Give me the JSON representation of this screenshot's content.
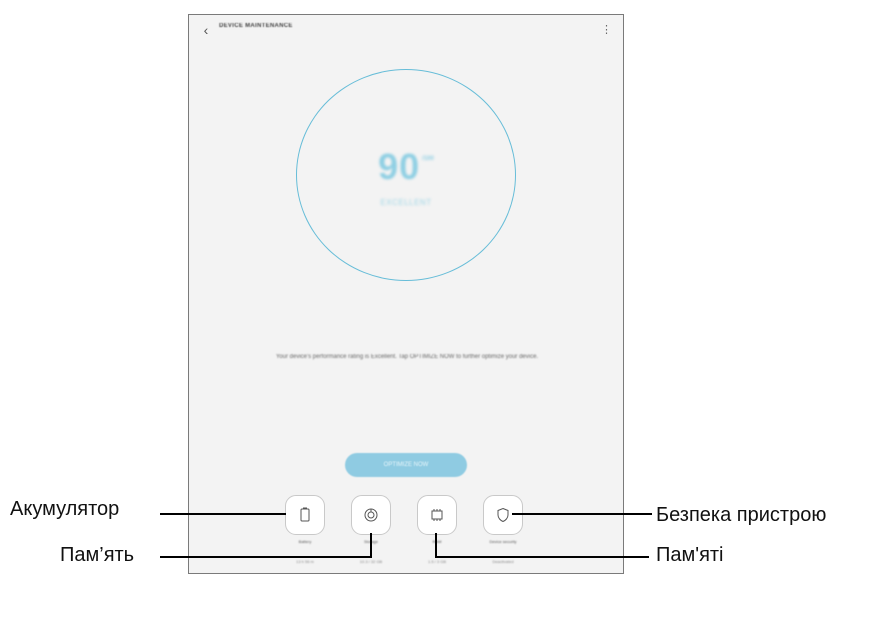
{
  "header": {
    "title": "DEVICE MAINTENANCE",
    "back_icon": "chevron-left-icon",
    "more_icon": "more-vert-icon"
  },
  "score": {
    "value": "90",
    "max": "/100",
    "rating": "EXCELLENT"
  },
  "message": "Your device's performance rating is Excellent. Tap OPTIMIZE NOW to further optimize your device.",
  "optimize_button": "OPTIMIZE NOW",
  "tiles": [
    {
      "icon": "battery-icon",
      "label": "Battery",
      "value": "13 h 56 m"
    },
    {
      "icon": "storage-icon",
      "label": "Storage",
      "value": "10.3 / 32 GB"
    },
    {
      "icon": "memory-chip-icon",
      "label": "RAM",
      "value": "1.5 / 3 GB"
    },
    {
      "icon": "shield-icon",
      "label": "Device security",
      "value": "Deactivated"
    }
  ],
  "callouts": {
    "battery": "Акумулятор",
    "storage": "Пам’ять",
    "memory": "Пам'яті",
    "security": "Безпека пристрою"
  },
  "colors": {
    "accent": "#67bdd8",
    "button": "#8fcbe2",
    "screen_bg": "#f3f3f3"
  }
}
